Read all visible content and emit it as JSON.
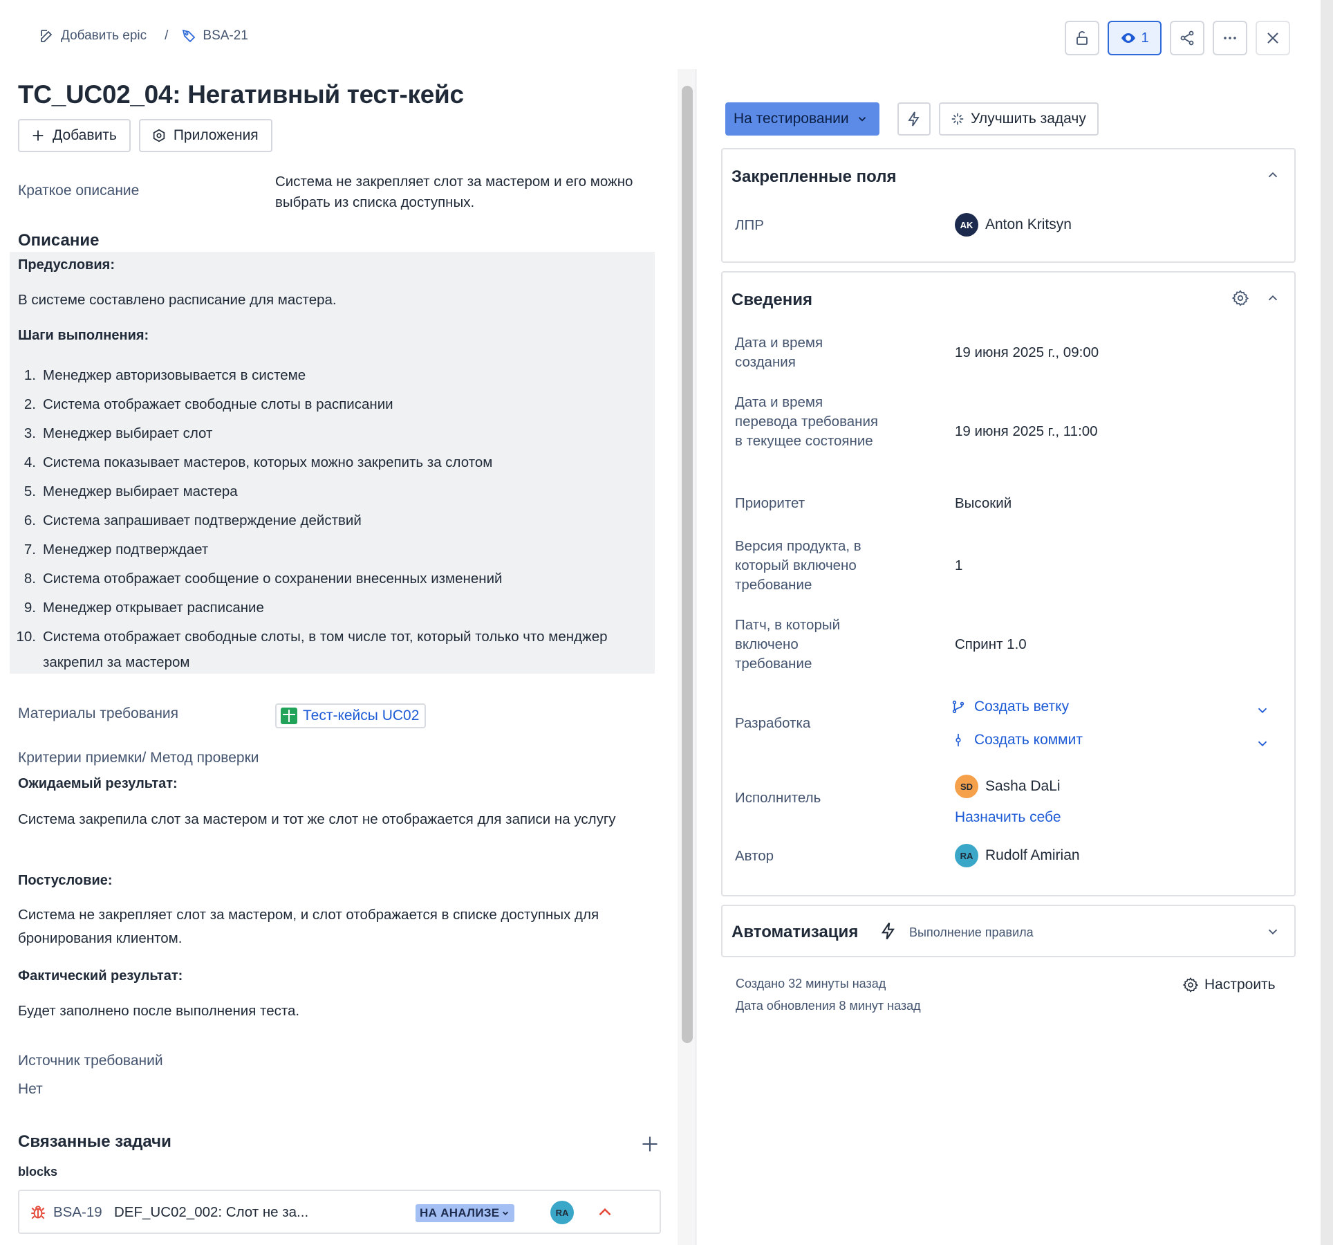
{
  "breadcrumb": {
    "add_epic": "Добавить epic",
    "separator": "/",
    "issue_key": "BSA-21"
  },
  "toolbar": {
    "watch_count": "1"
  },
  "issue": {
    "title": "TC_UC02_04: Негативный тест-кейс",
    "add_label": "Добавить",
    "apps_label": "Приложения"
  },
  "summary": {
    "label": "Краткое описание",
    "value": "Система не закрепляет слот за мастером и его можно выбрать из списка доступных."
  },
  "description": {
    "heading": "Описание",
    "preconditions_label": "Предусловия:",
    "preconditions_text": "В системе составлено расписание для мастера.",
    "steps_label": "Шаги выполнения:",
    "steps": [
      {
        "n": "1.",
        "t": "Менеджер авторизовывается в системе"
      },
      {
        "n": "2.",
        "t": "Система отображает свободные слоты в расписании"
      },
      {
        "n": "3.",
        "t": "Менеджер выбирает слот"
      },
      {
        "n": "4.",
        "t": "Система показывает мастеров, которых можно закрепить за слотом"
      },
      {
        "n": "5.",
        "t": "Менеджер выбирает мастера"
      },
      {
        "n": "6.",
        "t": "Система запрашивает подтверждение действий"
      },
      {
        "n": "7.",
        "t": "Менеджер подтверждает"
      },
      {
        "n": "8.",
        "t": "Система отображает сообщение о сохранении внесенных изменений"
      },
      {
        "n": "9.",
        "t": "Менеджер открывает расписание"
      },
      {
        "n": "10.",
        "t": "Система отображает свободные слоты, в том числе тот, который только что менджер закрепил за мастером"
      }
    ]
  },
  "materials": {
    "label": "Материалы требования",
    "link": "Тест-кейсы UC02"
  },
  "acceptance": {
    "label": "Критерии приемки/ Метод проверки",
    "expected_label": "Ожидаемый результат:",
    "expected_text": "Система закрепила слот за мастером и тот же слот не отображается для записи на услугу",
    "post_label": "Постусловие:",
    "post_text": "Система не закрепляет слот за мастером, и слот отображается в списке доступных для бронирования клиентом.",
    "actual_label": "Фактический результат:",
    "actual_text": "Будет заполнено после выполнения теста."
  },
  "source": {
    "label": "Источник требований",
    "value": "Нет"
  },
  "linked": {
    "heading": "Связанные задачи",
    "relation": "blocks",
    "items": [
      {
        "key": "BSA-19",
        "summary": "DEF_UC02_002: Слот не за...",
        "status": "НА АНАЛИЗЕ",
        "assignee_initials": "RA"
      }
    ]
  },
  "right": {
    "status_label": "На тестировании",
    "improve_label": "Улучшить задачу",
    "pinned": {
      "heading": "Закрепленные поля",
      "lpr_label": "ЛПР",
      "lpr_initials": "AK",
      "lpr_name": "Anton Kritsyn"
    },
    "details": {
      "heading": "Сведения",
      "created_label": "Дата и время создания",
      "created_value": "19 июня 2025 г., 09:00",
      "transition_label": "Дата и время перевода требования в текущее состояние",
      "transition_value": "19 июня 2025 г., 11:00",
      "priority_label": "Приоритет",
      "priority_value": "Высокий",
      "version_label": "Версия продукта, в который включено требование",
      "version_value": "1",
      "patch_label": "Патч, в который включено требование",
      "patch_value": "Спринт 1.0",
      "dev_label": "Разработка",
      "create_branch": "Создать ветку",
      "create_commit": "Создать коммит",
      "assignee_label": "Исполнитель",
      "assignee_initials": "SD",
      "assignee_name": "Sasha DaLi",
      "assign_to_me": "Назначить себе",
      "author_label": "Автор",
      "author_initials": "RA",
      "author_name": "Rudolf Amirian"
    },
    "automation": {
      "heading": "Автоматизация",
      "subtitle": "Выполнение правила"
    },
    "meta": {
      "created": "Создано 32 минуты назад",
      "updated": "Дата обновления 8 минут назад",
      "configure": "Настроить"
    }
  },
  "colors": {
    "status_blue": "#5b8be6",
    "link_blue": "#1d5bd6",
    "priority_red": "#e5493a",
    "bug_red": "#e5493a"
  }
}
